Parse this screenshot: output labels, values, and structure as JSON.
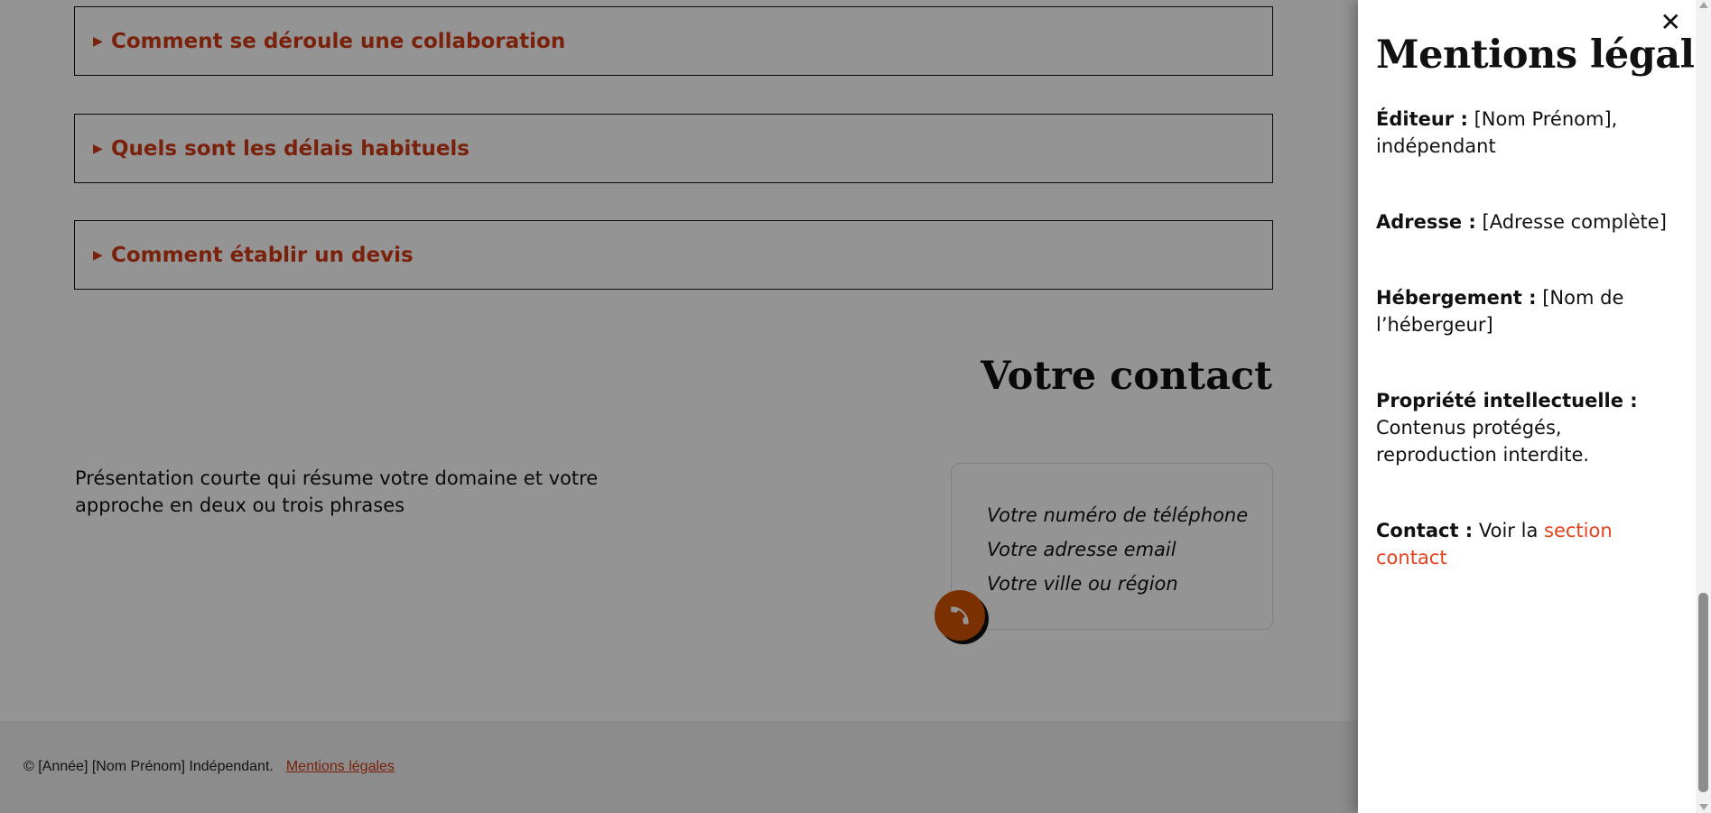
{
  "faq": [
    {
      "question": "Comment se déroule une collaboration"
    },
    {
      "question": "Quels sont les délais habituels"
    },
    {
      "question": "Comment établir un devis"
    }
  ],
  "faq_arrow": "▶",
  "contact": {
    "title": "Votre contact",
    "intro": "Présentation courte qui résume votre domaine et votre approche en deux ou trois phrases",
    "phone": "Votre numéro de téléphone",
    "email": "Votre adresse email",
    "city": "Votre ville ou région",
    "phone_icon": "phone-icon"
  },
  "footer": {
    "copyright": "© [Année] [Nom Prénom] Indépendant.",
    "legal_link": "Mentions légales"
  },
  "legal_panel": {
    "close_symbol": "✕",
    "title": "Mentions légales",
    "editor_label": "Éditeur :",
    "editor_value": "[Nom Prénom], indépendant",
    "address_label": "Adresse :",
    "address_value": "[Adresse complète]",
    "hosting_label": "Hébergement :",
    "hosting_value": "[Nom de l’hébergeur]",
    "ip_label": "Propriété intellectuelle :",
    "ip_value": "Contenus protégés, reproduction interdite.",
    "contact_label": "Contact :",
    "contact_text": "Voir la",
    "contact_link": "section contact"
  },
  "colors": {
    "accent": "#d03a14",
    "link": "#e8401c",
    "phone_button": "#d35400",
    "overlay": "rgba(0,0,0,0.42)"
  }
}
